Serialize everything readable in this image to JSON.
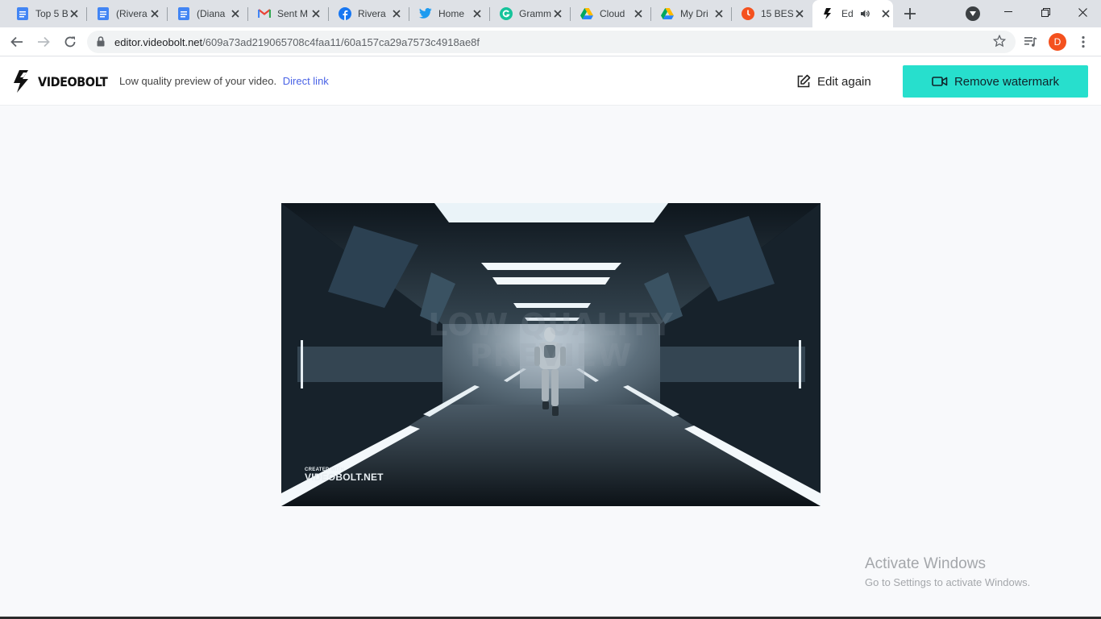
{
  "browser": {
    "tabs": [
      {
        "title": "Top 5 B",
        "icon": "google-docs-icon"
      },
      {
        "title": "(Rivera",
        "icon": "google-docs-icon"
      },
      {
        "title": "(Diana",
        "icon": "google-docs-icon"
      },
      {
        "title": "Sent M",
        "icon": "gmail-icon"
      },
      {
        "title": "Rivera",
        "icon": "facebook-icon"
      },
      {
        "title": "Home",
        "icon": "twitter-icon"
      },
      {
        "title": "Gramm",
        "icon": "grammarly-icon"
      },
      {
        "title": "Cloud",
        "icon": "google-drive-icon"
      },
      {
        "title": "My Dri",
        "icon": "google-drive-icon"
      },
      {
        "title": "15 BES",
        "icon": "site-icon"
      },
      {
        "title": "Ed",
        "icon": "videobolt-icon",
        "active": true
      }
    ],
    "url_host": "editor.videobolt.net",
    "url_path": "/609a73ad219065708c4faa11/60a157ca29a7573c4918ae8f",
    "profile_initial": "D"
  },
  "app": {
    "logo_text": "VIDEOBOLT",
    "preview_note": "Low quality preview of your video.",
    "direct_link": "Direct link",
    "edit_again": "Edit again",
    "remove_watermark": "Remove watermark"
  },
  "video": {
    "watermark_line1": "LOW QUALITY",
    "watermark_line2": "PREVIEW",
    "corner_small": "CREATED WITH",
    "corner_big": "VIDEOBOLT.NET"
  },
  "windows_notice": {
    "title": "Activate Windows",
    "subtitle": "Go to Settings to activate Windows."
  },
  "colors": {
    "accent": "#27dfcd",
    "link": "#4a63e6"
  }
}
